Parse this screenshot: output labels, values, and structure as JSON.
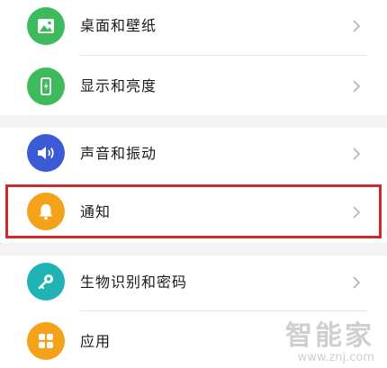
{
  "settings": {
    "items": [
      {
        "label": "桌面和壁纸",
        "icon": "picture-icon",
        "color": "#3dbb5c"
      },
      {
        "label": "显示和亮度",
        "icon": "phone-brightness-icon",
        "color": "#3dbb5c"
      },
      {
        "label": "声音和振动",
        "icon": "speaker-icon",
        "color": "#3b5bd6"
      },
      {
        "label": "通知",
        "icon": "bell-icon",
        "color": "#f4a21a"
      },
      {
        "label": "生物识别和密码",
        "icon": "key-icon",
        "color": "#1fb3b3"
      },
      {
        "label": "应用",
        "icon": "apps-grid-icon",
        "color": "#f4a21a"
      }
    ]
  },
  "watermark": {
    "brand": "智能家",
    "url": "www.znj.com"
  }
}
